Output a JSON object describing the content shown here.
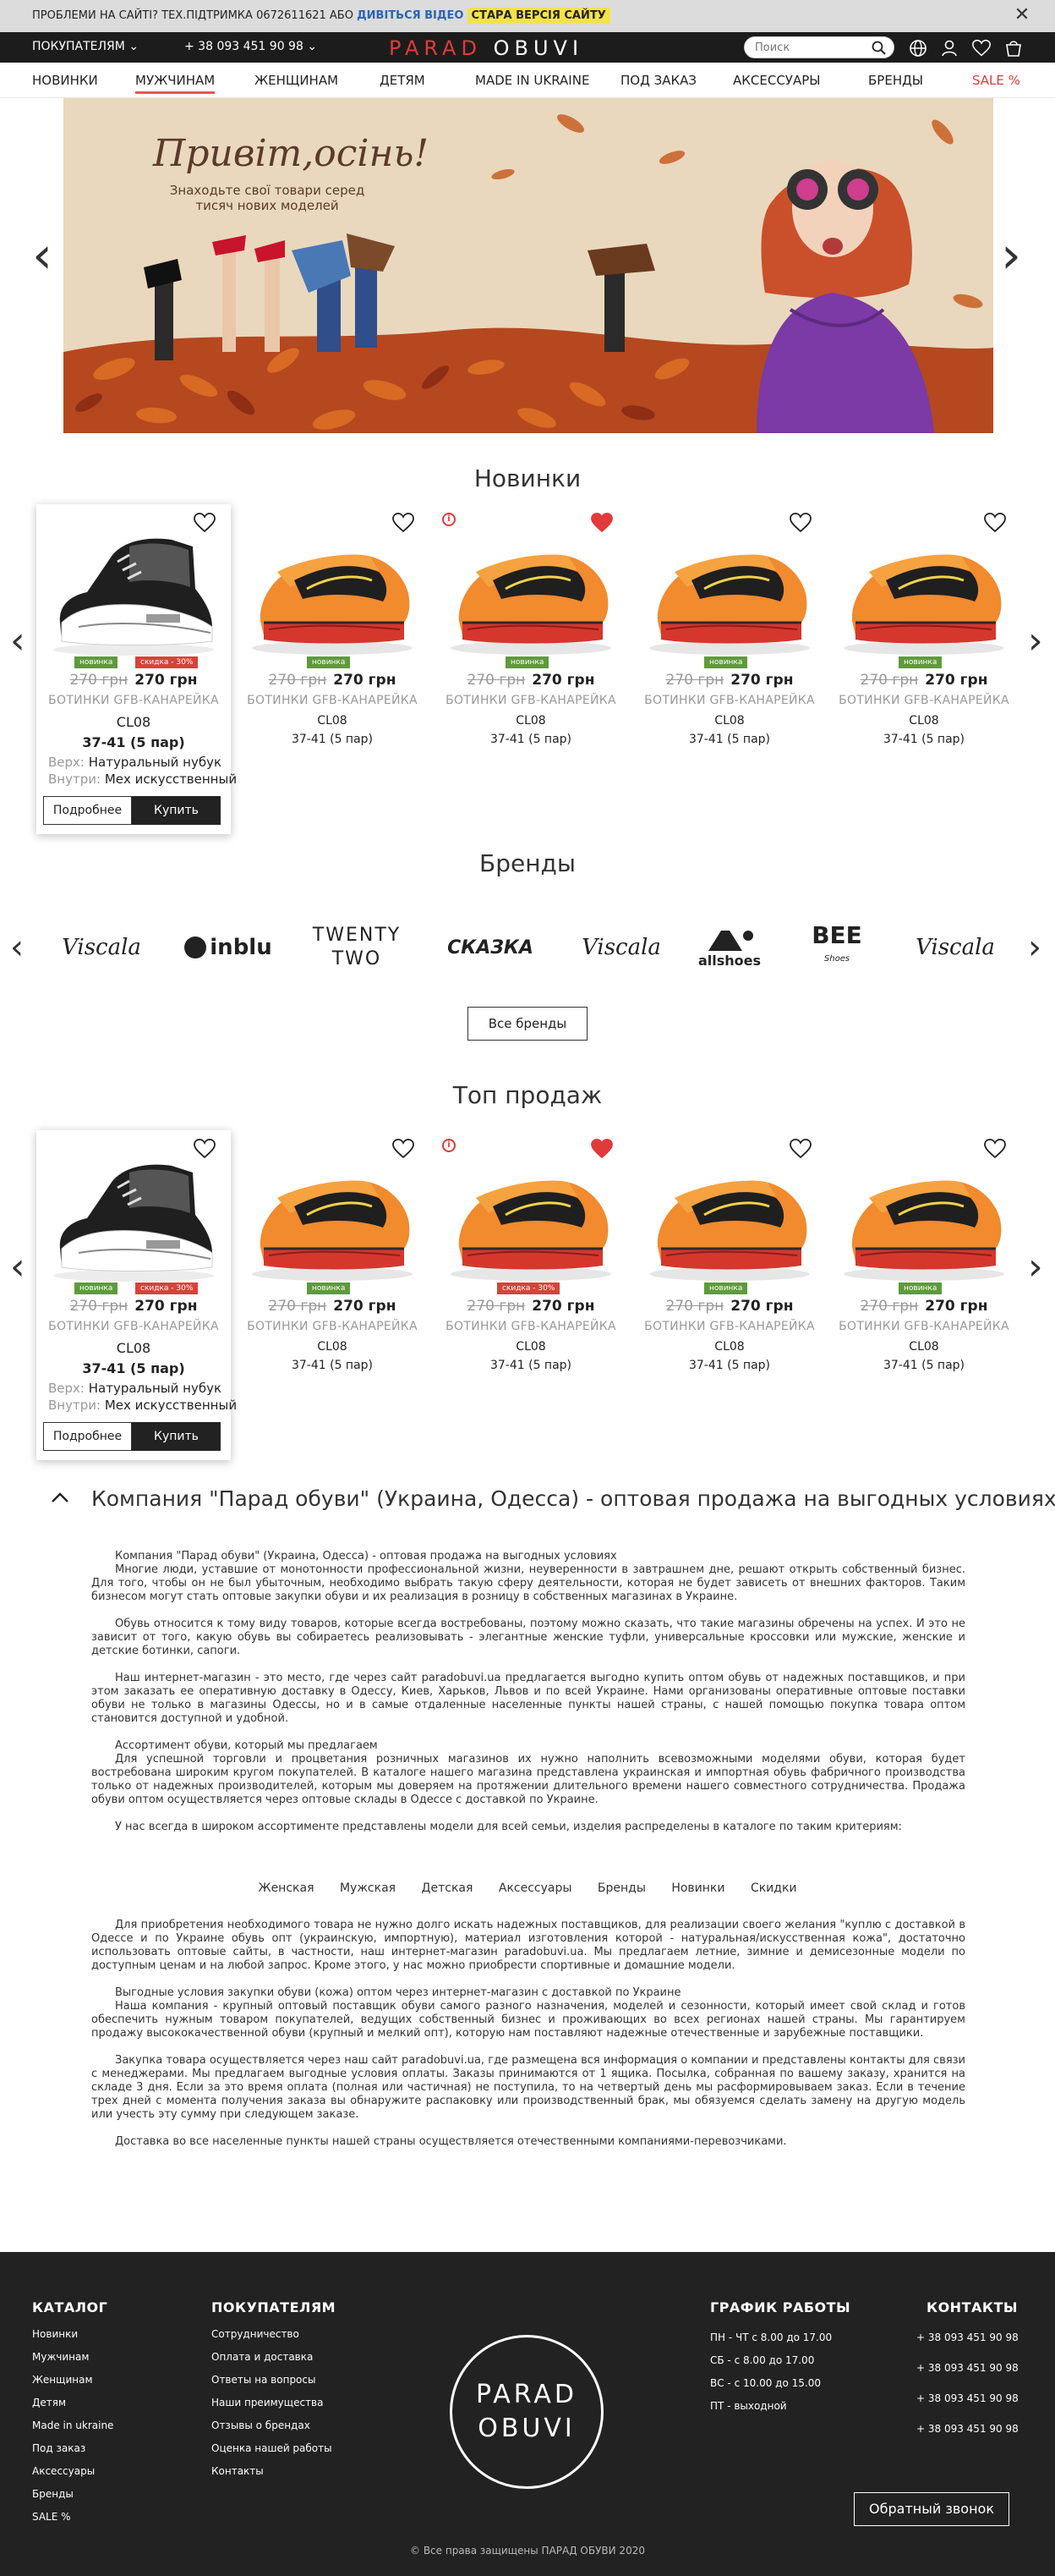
{
  "notice": {
    "text": "ПРОБЛЕМИ НА САЙТІ? ТЕХ.ПІДТРИМКА 0672611621 АБО",
    "video_link": "ДИВІТЬСЯ ВІДЕО",
    "old_site": "СТАРА ВЕРСІЯ САЙТУ",
    "close_icon": "close-icon"
  },
  "header": {
    "customers": "ПОКУПАТЕЛЯМ",
    "phone": "+ 38 093 451 90 98",
    "logo_left": "PARAD",
    "logo_right": "OBUVI",
    "search_placeholder": "Поиск"
  },
  "nav": [
    "НОВИНКИ",
    "МУЖЧИНАМ",
    "ЖЕНЩИНАМ",
    "ДЕТЯМ",
    "MADE IN UKRAINE",
    "ПОД ЗАКАЗ",
    "АКСЕССУАРЫ",
    "БРЕНДЫ",
    "SALE %"
  ],
  "banner": {
    "title": "Привіт,осінь!",
    "subtitle_1": "Знаходьте свої товари серед",
    "subtitle_2": "тисяч нових моделей"
  },
  "new_title": "Новинки",
  "top_title": "Топ продаж",
  "brands_title": "Бренды",
  "all_brands": "Все бренды",
  "badges": {
    "new": "новинка",
    "sale": "скидка - 30%"
  },
  "products": {
    "old_price": "270 грн",
    "price": "270 грн",
    "name": "БОТИНКИ GFB-КАНАРЕЙКА",
    "code": "CL08",
    "sizes_bold": "37-41 (5 пар)",
    "sizes": "37-41 (5 пар)",
    "upper_label": "Верх:",
    "upper_value": "Натуральный нубук",
    "inner_label": "Внутри:",
    "inner_value": "Мех искусственный",
    "more": "Подробнее",
    "buy": "Купить"
  },
  "brands": [
    "Viscala",
    "inblu",
    "TWENTY TWO",
    "СКАЗКА",
    "Viscala",
    "allshoes",
    "BEE",
    "Viscala"
  ],
  "brand_sub": {
    "twenty_two_top": "TWENTY",
    "twenty_two_bottom": "TWO",
    "bee_sub": "Shoes"
  },
  "company": {
    "title": "Компания \"Парад обуви\" (Украина, Одесса) - оптовая продажа на выгодных условиях",
    "p1_head": "Компания \"Парад обуви\" (Украина, Одесса) - оптовая продажа на выгодных условиях",
    "p1": "Многие люди, уставшие от монотонности профессиональной жизни, неуверенности в завтрашнем дне, решают открыть собственный бизнес. Для того, чтобы он не был убыточным, необходимо выбрать такую сферу деятельности, которая не будет зависеть от внешних факторов. Таким бизнесом могут стать оптовые закупки обуви и их реализация в розницу в собственных магазинах в Украине.",
    "p2": "Обувь относится к тому виду товаров, которые всегда востребованы, поэтому можно сказать, что такие магазины обречены на успех. И это не зависит от того, какую обувь вы собираетесь реализовывать - элегантные женские туфли, универсальные кроссовки или мужские, женские и детские ботинки, сапоги.",
    "p3": "Наш интернет-магазин - это место, где через сайт paradobuvi.ua предлагается выгодно купить оптом обувь от надежных поставщиков, и при этом заказать ее оперативную доставку в Одессу, Киев, Харьков, Львов и по всей Украине. Нами организованы оперативные оптовые поставки обуви не только в магазины Одессы, но и в самые отдаленные населенные пункты нашей страны, с нашей помощью покупка товара оптом становится доступной и удобной.",
    "p4_head": "Ассортимент обуви, который мы предлагаем",
    "p4": "Для успешной торговли и процветания розничных магазинов их нужно наполнить всевозможными моделями обуви, которая будет востребована широким кругом покупателей. В каталоге нашего магазина представлена украинская и импортная обувь фабричного производства только от надежных производителей, которым мы доверяем на протяжении длительного времени нашего совместного сотрудничества. Продажа обуви оптом осуществляется через оптовые склады в Одессе с доставкой по Украине.",
    "p5": "У нас всегда в широком ассортименте представлены модели для всей семьи, изделия распределены в каталоге по таким критериям:",
    "cats": [
      "Женская",
      "Мужская",
      "Детская",
      "Аксессуары",
      "Бренды",
      "Новинки",
      "Скидки"
    ],
    "p6": "Для приобретения необходимого товара не нужно долго искать надежных поставщиков, для реализации своего желания \"куплю с доставкой в Одессе и по Украине обувь опт (украинскую, импортную), материал изготовления которой - натуральная/искусственная кожа\", достаточно использовать оптовые сайты, в частности, наш интернет-магазин paradobuvi.ua. Мы предлагаем летние, зимние и демисезонные модели по доступным ценам и на любой запрос. Кроме этого, у нас можно приобрести спортивные и домашние модели.",
    "p7_head": "Выгодные условия закупки обуви (кожа) оптом через интернет-магазин с доставкой по Украине",
    "p7": "Наша компания - крупный оптовый поставщик обуви самого разного назначения, моделей и сезонности, который имеет свой склад и готов обеспечить нужным товаром покупателей, ведущих собственный бизнес и проживающих во всех регионах нашей страны. Мы гарантируем продажу высококачественной обуви (крупный и мелкий опт), которую нам поставляют надежные отечественные и зарубежные поставщики.",
    "p8": "Закупка товара осуществляется через наш сайт paradobuvi.ua, где размещена вся информация о компании и представлены контакты для связи с менеджерами. Мы предлагаем выгодные условия оплаты. Заказы принимаются от 1 ящика. Посылка, собранная по вашему заказу, хранится на складе 3 дня. Если за это время оплата (полная или частичная) не поступила, то на четвертый день мы расформировываем заказ. Если в течение трех дней с момента получения заказа вы обнаружите распаковку или производственный брак, мы обязуемся сделать замену на другую модель или учесть эту сумму при следующем заказе.",
    "p9": "Доставка во все населенные пункты нашей страны осуществляется отечественными компаниями-перевозчиками."
  },
  "footer": {
    "catalog_title": "КАТАЛОГ",
    "catalog": [
      "Новинки",
      "Мужчинам",
      "Женщинам",
      "Детям",
      "Made in ukraine",
      "Под заказ",
      "Аксессуары",
      "Бренды",
      "SALE %"
    ],
    "customers_title": "ПОКУПАТЕЛЯМ",
    "customers": [
      "Сотрудничество",
      "Оплата и доставка",
      "Ответы на вопросы",
      "Наши преимущества",
      "Отзывы о брендах",
      "Оценка нашей работы",
      "Контакты"
    ],
    "logo_top": "PARAD",
    "logo_bottom": "OBUVI",
    "schedule_title": "ГРАФИК РАБОТЫ",
    "schedule": [
      "ПН - ЧТ с 8.00 до 17.00",
      "СБ - с 8.00 до 17.00",
      "ВС - с 10.00 до 15.00",
      "ПТ - выходной"
    ],
    "contacts_title": "КОНТАКТЫ",
    "phones": [
      "+ 38 093 451 90 98",
      "+ 38 093 451 90 98",
      "+ 38 093 451 90 98",
      "+ 38 093 451 90 98"
    ],
    "callback": "Обратный звонок",
    "copyright": "© Все права защищены ПАРАД ОБУВИ 2020"
  }
}
